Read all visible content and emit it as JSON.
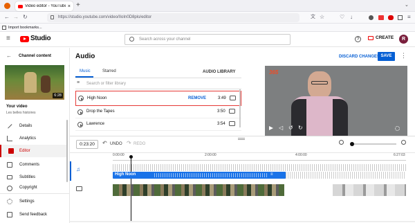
{
  "browser": {
    "tab_title": "Video editor - YouTube Studio",
    "close_tab": "×",
    "new_tab": "+",
    "url": "https://studio.youtube.com/video/IIoIn0D8plo/editor",
    "bookmarks_import": "Import bookmarks..."
  },
  "header": {
    "logo_text": "Studio",
    "search_placeholder": "Search across your channel",
    "create_label": "CREATE",
    "avatar_letter": "R",
    "help": "?"
  },
  "sidebar": {
    "back_label": "Channel content",
    "thumb_duration": "6:28",
    "your_video": "Your video",
    "video_name": "Les belles histoires",
    "items": [
      {
        "label": "Details",
        "icon": "pencil-icon"
      },
      {
        "label": "Analytics",
        "icon": "analytics-icon"
      },
      {
        "label": "Editor",
        "icon": "editor-icon",
        "active": true
      },
      {
        "label": "Comments",
        "icon": "comments-icon"
      },
      {
        "label": "Subtitles",
        "icon": "subtitles-icon"
      },
      {
        "label": "Copyright",
        "icon": "copyright-icon"
      },
      {
        "label": "Settings",
        "icon": "gear-icon"
      },
      {
        "label": "Send feedback",
        "icon": "feedback-icon"
      }
    ]
  },
  "main": {
    "title": "Audio",
    "discard": "DISCARD CHANGES",
    "save": "SAVE",
    "tabs": [
      "Music",
      "Starred"
    ],
    "library": "AUDIO LIBRARY",
    "filter_placeholder": "Search or filter library",
    "tracks": [
      {
        "name": "High Noon",
        "duration": "3:49",
        "remove": "REMOVE",
        "selected": true
      },
      {
        "name": "Drop the Tapes",
        "duration": "3:50"
      },
      {
        "name": "Lawrence",
        "duration": "3:54"
      }
    ],
    "video_logo": "365"
  },
  "timeline": {
    "timecode": "0:23:20",
    "undo": "UNDO",
    "redo": "REDO",
    "ticks": [
      "0:00:00",
      "2:00:00",
      "4:00:00",
      "6:27:03"
    ],
    "audio_clip": "High Noon"
  },
  "colors": {
    "accent": "#065fd4",
    "brand": "#ff0000",
    "active": "#cc0000",
    "selection": "#e53935"
  }
}
